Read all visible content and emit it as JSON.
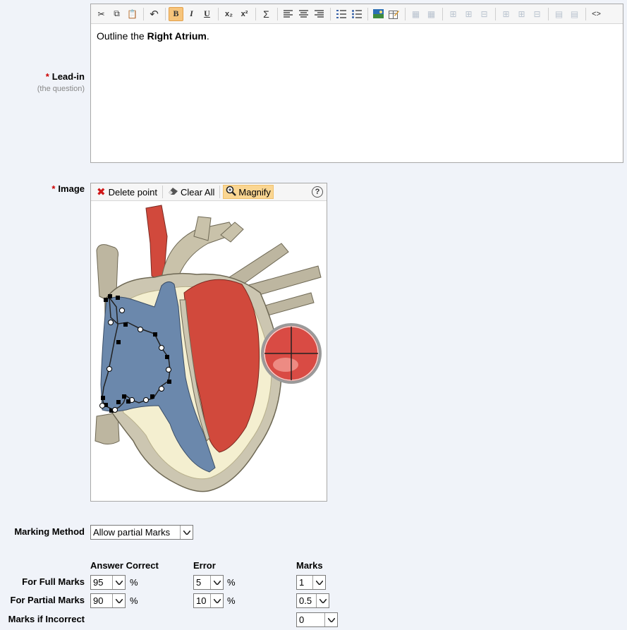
{
  "leadin": {
    "label": "Lead-in",
    "sublabel": "(the question)",
    "required_mark": "*",
    "content_prefix": "Outline the ",
    "content_bold": "Right Atrium",
    "content_suffix": "."
  },
  "toolbar": {
    "bold": "B",
    "italic": "I",
    "underline": "U",
    "subscript": "x₂",
    "superscript": "x²",
    "sigma": "Σ",
    "source": "<>"
  },
  "image": {
    "label": "Image",
    "required_mark": "*",
    "delete_point": "Delete point",
    "clear_all": "Clear All",
    "magnify": "Magnify",
    "help": "?"
  },
  "marking": {
    "method_label": "Marking Method",
    "method_value": "Allow partial Marks",
    "col_answer": "Answer Correct",
    "col_error": "Error",
    "col_marks": "Marks",
    "rows": [
      {
        "label": "For Full Marks",
        "answer": "95",
        "answer_unit": "%",
        "error": "5",
        "error_unit": "%",
        "marks": "1"
      },
      {
        "label": "For Partial Marks",
        "answer": "90",
        "answer_unit": "%",
        "error": "10",
        "error_unit": "%",
        "marks": "0.5"
      }
    ],
    "incorrect_label": "Marks if Incorrect",
    "incorrect_value": "0"
  },
  "colors": {
    "accent": "#f6c47b",
    "required": "#cc0000",
    "blood_red": "#d1493c",
    "blood_blue": "#6b88ac",
    "tissue": "#ccc6b1"
  }
}
